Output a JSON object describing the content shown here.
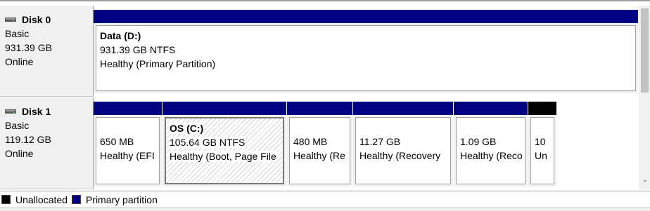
{
  "disks": [
    {
      "name": "Disk 0",
      "type": "Basic",
      "size": "931.39 GB",
      "status": "Online",
      "partitions": [
        {
          "name": "Data  (D:)",
          "size": "931.39 GB NTFS",
          "status": "Healthy (Primary Partition)"
        }
      ]
    },
    {
      "name": "Disk 1",
      "type": "Basic",
      "size": "119.12 GB",
      "status": "Online",
      "partitions": [
        {
          "name": "",
          "size": "650 MB",
          "status": "Healthy (EFI"
        },
        {
          "name": "OS  (C:)",
          "size": "105.64 GB NTFS",
          "status": "Healthy (Boot, Page File"
        },
        {
          "name": "",
          "size": "480 MB",
          "status": "Healthy (Re"
        },
        {
          "name": "",
          "size": "11.27 GB",
          "status": "Healthy (Recovery"
        },
        {
          "name": "",
          "size": "1.09 GB",
          "status": "Healthy (Reco"
        },
        {
          "name": "",
          "size": "10",
          "status": "Un",
          "unallocated": true
        }
      ]
    }
  ],
  "legend": [
    {
      "label": "Unallocated",
      "color": "#000000"
    },
    {
      "label": "Primary partition",
      "color": "#000080"
    }
  ],
  "icons": {
    "disk": "disk-drive-icon",
    "scroll_down": "chevron-down-icon"
  }
}
